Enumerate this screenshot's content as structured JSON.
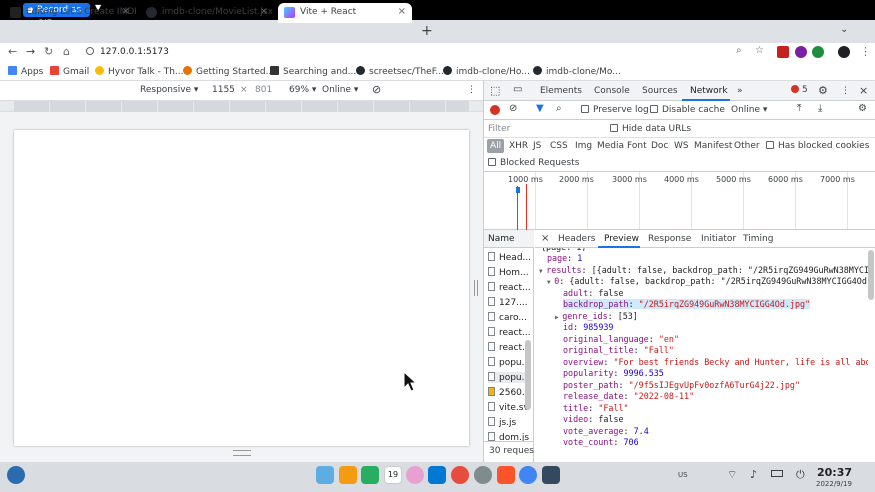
{
  "recorder": {
    "label": "Record as GIF"
  },
  "tabs": [
    {
      "title": "Editing Let's Create IMDB"
    },
    {
      "title": "imdb-clone/MovieList.jsx a"
    },
    {
      "title": "Vite + React"
    }
  ],
  "address": {
    "url": "127.0.0.1:5173"
  },
  "bookmarks": [
    {
      "label": "Apps"
    },
    {
      "label": "Gmail"
    },
    {
      "label": "Hyvor Talk - Th..."
    },
    {
      "label": "Getting Started..."
    },
    {
      "label": "Searching and..."
    },
    {
      "label": "screetsec/TheF..."
    },
    {
      "label": "imdb-clone/Ho..."
    },
    {
      "label": "imdb-clone/Mo..."
    }
  ],
  "device_toolbar": {
    "device": "Responsive ▾",
    "width": "1155",
    "height": "801",
    "zoom": "69% ▾",
    "throttle": "Online ▾"
  },
  "devtools": {
    "tabs": [
      "Elements",
      "Console",
      "Sources",
      "Network",
      "»"
    ],
    "selected_tab": "Network",
    "error_count": "5",
    "network": {
      "preserve_log": "Preserve log",
      "disable_cache": "Disable cache",
      "throttle": "Online ▾",
      "filter_placeholder": "Filter",
      "hide_data_urls": "Hide data URLs",
      "types": [
        "All",
        "XHR",
        "JS",
        "CSS",
        "Img",
        "Media",
        "Font",
        "Doc",
        "WS",
        "Manifest",
        "Other"
      ],
      "has_blocked_cookies": "Has blocked cookies",
      "blocked_requests": "Blocked Requests",
      "timeline_ticks": [
        "1000 ms",
        "2000 ms",
        "3000 ms",
        "4000 ms",
        "5000 ms",
        "6000 ms",
        "7000 ms"
      ],
      "name_header": "Name",
      "requests": [
        "Head...",
        "Hom...",
        "react...",
        "127....",
        "caro...",
        "react...",
        "react...",
        "popu...",
        "popu...",
        "2560...",
        "vite.sv",
        "js.js",
        "dom.js"
      ],
      "request_count": "30 requests",
      "detail_tabs": [
        "×",
        "Headers",
        "Preview",
        "Response",
        "Initiator",
        "Timing"
      ],
      "preview_lines": [
        {
          "indent": 1,
          "key": "page",
          "val": "1",
          "type": "n"
        },
        {
          "indent": 1,
          "arrow": "▼",
          "key": "results",
          "val": "[{adult: false, backdrop_path: \"/2R5irqZG949GuRwN38MYCIGG",
          "type": "p"
        },
        {
          "indent": 2,
          "arrow": "▼",
          "key": "0",
          "val": "{adult: false, backdrop_path: \"/2R5irqZG949GuRwN38MYCIGG4Od.jp",
          "type": "p"
        },
        {
          "indent": 3,
          "key": "adult",
          "val": "false",
          "type": "p"
        },
        {
          "indent": 3,
          "key": "backdrop_path",
          "val": "\"/2R5irqZG949GuRwN38MYCIGG4Od.jpg\"",
          "type": "s",
          "hl": true
        },
        {
          "indent": 3,
          "arrow": "▶",
          "key": "genre_ids",
          "val": "[53]",
          "type": "p"
        },
        {
          "indent": 3,
          "key": "id",
          "val": "985939",
          "type": "n"
        },
        {
          "indent": 3,
          "key": "original_language",
          "val": "\"en\"",
          "type": "s"
        },
        {
          "indent": 3,
          "key": "original_title",
          "val": "\"Fall\"",
          "type": "s"
        },
        {
          "indent": 3,
          "key": "overview",
          "val": "\"For best friends Becky and Hunter, life is all about",
          "type": "s"
        },
        {
          "indent": 3,
          "key": "popularity",
          "val": "9996.535",
          "type": "n"
        },
        {
          "indent": 3,
          "key": "poster_path",
          "val": "\"/9f5sIJEgvUpFv0ozfA6TurG4j22.jpg\"",
          "type": "s"
        },
        {
          "indent": 3,
          "key": "release_date",
          "val": "\"2022-08-11\"",
          "type": "s"
        },
        {
          "indent": 3,
          "key": "title",
          "val": "\"Fall\"",
          "type": "s"
        },
        {
          "indent": 3,
          "key": "video",
          "val": "false",
          "type": "p"
        },
        {
          "indent": 3,
          "key": "vote_average",
          "val": "7.4",
          "type": "n"
        },
        {
          "indent": 3,
          "key": "vote_count",
          "val": "706",
          "type": "n"
        }
      ]
    }
  },
  "taskbar": {
    "time": "20:37",
    "date": "2022/9/19",
    "lang": "US",
    "calendar_day": "19"
  },
  "colors": {
    "accent": "#1a73e8",
    "record": "#d93025"
  }
}
